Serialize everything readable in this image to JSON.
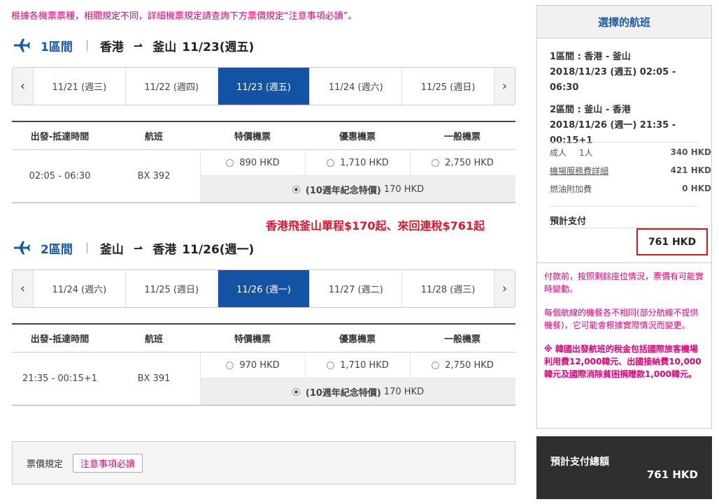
{
  "notice": "根據各機票票種，相關規定不同，詳細機票規定請查詢下方票價規定“注意事項必讀”。",
  "segments": [
    {
      "num": "1區間",
      "from": "香港",
      "to": "釜山",
      "date": "11/23(週五)",
      "dates": [
        "11/21 (週三)",
        "11/22 (週四)",
        "11/23 (週五)",
        "11/24 (週六)",
        "11/25 (週日)"
      ],
      "active_index": 2,
      "headers": [
        "出發-抵達時間",
        "航班",
        "特價機票",
        "優惠機票",
        "一般機票"
      ],
      "time": "02:05 - 06:30",
      "flight": "BX 392",
      "fare1": "890 HKD",
      "fare2": "1,710 HKD",
      "fare3": "2,750 HKD",
      "special_name": "(10週年紀念特價)",
      "special_price": "170 HKD"
    },
    {
      "num": "2區間",
      "from": "釜山",
      "to": "香港",
      "date": "11/26(週一)",
      "dates": [
        "11/24 (週六)",
        "11/25 (週日)",
        "11/26 (週一)",
        "11/27 (週二)",
        "11/28 (週三)"
      ],
      "active_index": 2,
      "headers": [
        "出發-抵達時間",
        "航班",
        "特價機票",
        "優惠機票",
        "一般機票"
      ],
      "time": "21:35 - 00:15+1",
      "flight": "BX 391",
      "fare1": "970 HKD",
      "fare2": "1,710 HKD",
      "fare3": "2,750 HKD",
      "special_name": "(10週年紀念特價)",
      "special_price": "170 HKD"
    }
  ],
  "promo": "香港飛釜山單程$170起、來回連稅$761起",
  "policy": {
    "label": "票價規定",
    "button": "注意事項必讀"
  },
  "panel": {
    "title": "選擇的航班",
    "seg1_line1": "1區間 : 香港 - 釜山",
    "seg1_line2": "2018/11/23 (週五) 02:05 - 06:30",
    "seg2_line1": "2區間 : 釜山 - 香港",
    "seg2_line2": "2018/11/26 (週一) 21:35 -",
    "seg2_line3": "00:15+1",
    "adult_label": "成人",
    "adult_count": "1人",
    "adult_price": "340 HKD",
    "service_label": "機場服務費詳細",
    "service_price": "421 HKD",
    "fuel_label": "燃油附加費",
    "fuel_price": "0 HKD",
    "est_label": "預計支付",
    "est_value": "761 HKD",
    "notes": [
      "付款前，按照剩餘座位情況，票價有可能實時變動。",
      "每個航線的機餐各不相同(部分航線不提供機餐)，它可能會根據實際情況而變更。",
      "※ 韓國出發航班的稅金包括國際旅客機場利用費12,000韓元、出國接納費10,000韓元及國際消除貧困捐贈款1,000韓元。"
    ]
  },
  "total": {
    "label": "預計支付總額",
    "value": "761 HKD"
  }
}
